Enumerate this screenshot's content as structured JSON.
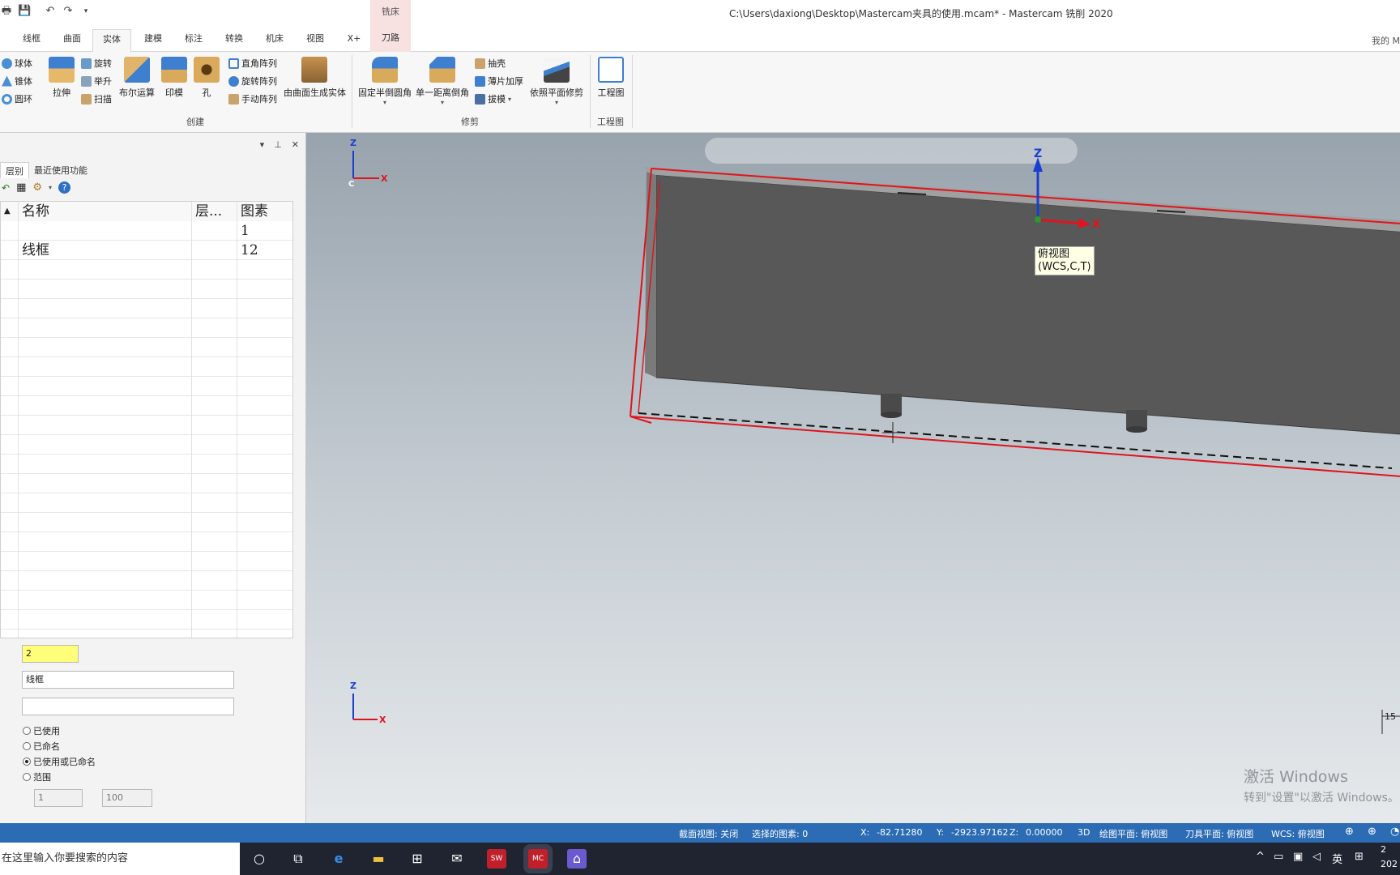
{
  "window": {
    "title": "C:\\Users\\daxiong\\Desktop\\Mastercam夹具的使用.mcam* - Mastercam 铣削 2020",
    "context_label": "铣床",
    "my_label": "我的 M"
  },
  "tabs": [
    "线框",
    "曲面",
    "实体",
    "建模",
    "标注",
    "转换",
    "机床",
    "视图",
    "X+",
    "刀路"
  ],
  "ribbon": {
    "primitives": [
      "球体",
      "锥体",
      "圆环"
    ],
    "extrude": "拉伸",
    "small1": [
      "旋转",
      "举升",
      "扫描"
    ],
    "boolean": "布尔运算",
    "imprint": "印模",
    "hole": "孔",
    "patterns": [
      "直角阵列",
      "旋转阵列",
      "手动阵列"
    ],
    "from_surfaces": "由曲面生成实体",
    "group_create": "创建",
    "fillet": "固定半倒圆角",
    "chamfer": "单一距离倒角",
    "small2": [
      "抽壳",
      "薄片加厚",
      "拔模"
    ],
    "trim_plane": "依照平面修剪",
    "group_modify": "修剪",
    "drawing": "工程图",
    "group_drawing": "工程图"
  },
  "panel": {
    "tabs": [
      "层别",
      "最近使用功能"
    ],
    "columns": [
      "名称",
      "层...",
      "图素"
    ],
    "rows": [
      {
        "name": "",
        "layer": "",
        "count": "1"
      },
      {
        "name": "线框",
        "layer": "",
        "count": "12"
      }
    ],
    "number_value": "2",
    "name_value": "线框",
    "set_value": "",
    "radios": [
      "已使用",
      "已命名",
      "已使用或已命名",
      "范围"
    ],
    "radio_selected": 2,
    "range_from": "1",
    "range_to": "100"
  },
  "viewport": {
    "tooltip_line1": "俯视图",
    "tooltip_line2": "(WCS,C,T)",
    "axis_z": "Z",
    "axis_x": "X",
    "axis_c": "C",
    "gizmo_z": "Z",
    "gizmo_x": "X",
    "watermark_line1": "激活 Windows",
    "watermark_line2": "转到\"设置\"以激活 Windows。",
    "scale_text": "15"
  },
  "status": {
    "section_view": "截面视图: 关闭",
    "selected": "选择的图素: 0",
    "x_label": "X:",
    "x_value": "-82.71280",
    "y_label": "Y:",
    "y_value": "-2923.97162",
    "z_label": "Z:",
    "z_value": "0.00000",
    "mode": "3D",
    "draw_plane": "绘图平面: 俯视图",
    "tool_plane": "刀具平面: 俯视图",
    "wcs": "WCS: 俯视图"
  },
  "taskbar": {
    "search_placeholder": "在这里输入你要搜索的内容",
    "ime": "英",
    "clock_top": "2",
    "clock_bottom": "202"
  },
  "colors": {
    "status_bar": "#2b6cb5",
    "taskbar": "#1f2430",
    "selection_red": "#e0141e",
    "part_dark": "#585858",
    "highlight_yellow": "#ffff7a"
  }
}
